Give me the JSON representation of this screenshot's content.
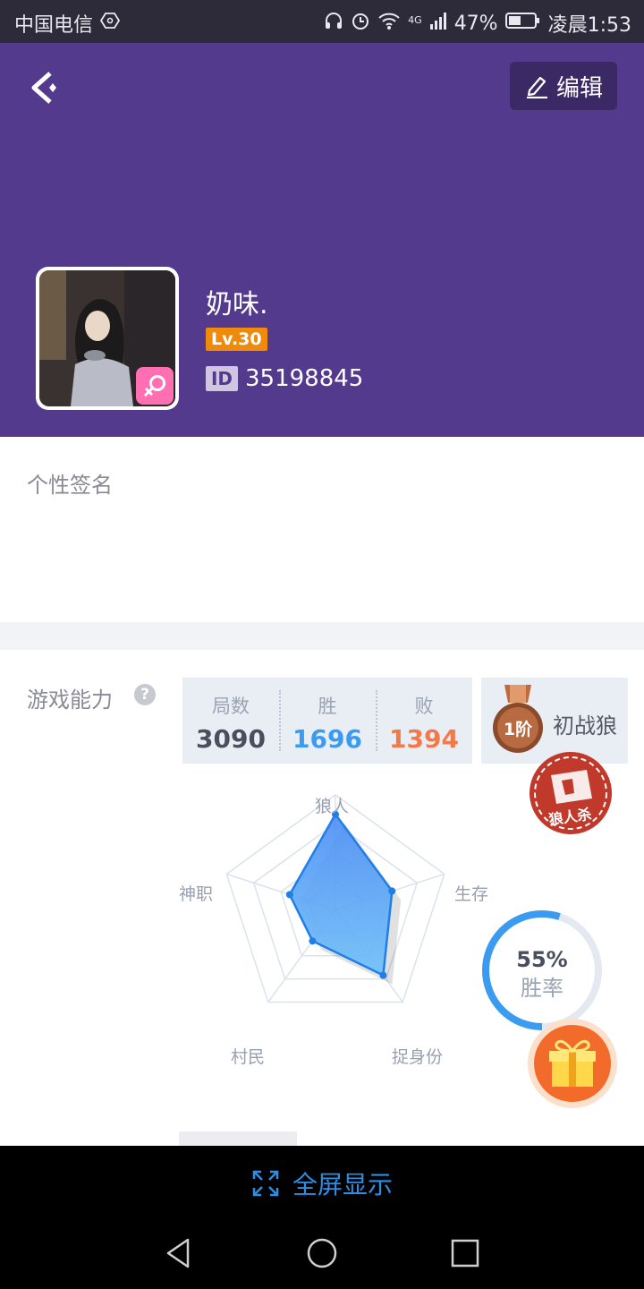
{
  "status_bar": {
    "carrier": "中国电信",
    "network": "4G",
    "battery": "47%",
    "time": "凌晨1:53"
  },
  "header": {
    "edit_label": "编辑",
    "nickname": "奶味.",
    "level": "Lv.30",
    "id_label": "ID",
    "id_value": "35198845",
    "gender_icon": "female-icon"
  },
  "signature": {
    "label": "个性签名"
  },
  "ability": {
    "label": "游戏能力",
    "help": "?",
    "stats": [
      {
        "title": "局数",
        "value": "3090",
        "color": "#4a4f5e"
      },
      {
        "title": "胜",
        "value": "1696",
        "color": "#3a9bf0"
      },
      {
        "title": "败",
        "value": "1394",
        "color": "#f07a4a"
      }
    ],
    "rank_badge": "1阶",
    "rank_title": "初战狼",
    "stamp_text": "狼人杀",
    "radar": {
      "axes": [
        "狼人",
        "生存",
        "捉身份",
        "村民",
        "神职"
      ],
      "values": [
        0.83,
        0.52,
        0.71,
        0.34,
        0.42
      ]
    },
    "win_rate": {
      "value": "55%",
      "label": "胜率",
      "fraction": 0.55
    }
  },
  "footer": {
    "fullscreen_label": "全屏显示"
  },
  "colors": {
    "header": "#533a8c",
    "accent": "#3a9bf0",
    "lose": "#f07a4a",
    "level": "#f08a0a"
  }
}
